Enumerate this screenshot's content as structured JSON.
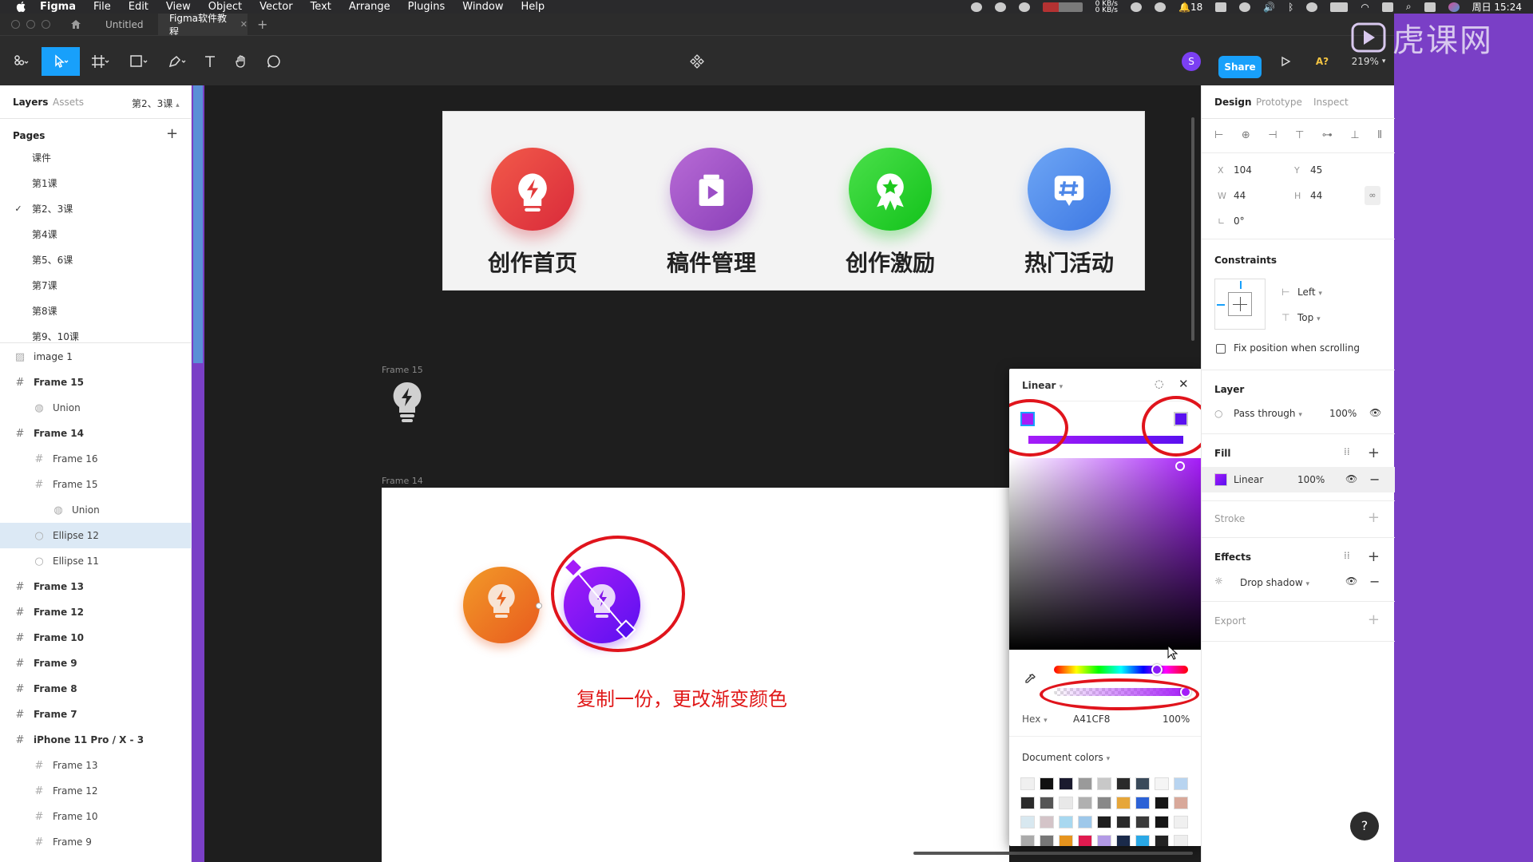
{
  "menubar": {
    "app": "Figma",
    "items": [
      "File",
      "Edit",
      "View",
      "Object",
      "Vector",
      "Text",
      "Arrange",
      "Plugins",
      "Window",
      "Help"
    ],
    "net_speed": "0 KB/s",
    "net_speed2": "0 KB/s",
    "notif_count": "18",
    "clock": "周日 15:24"
  },
  "tabs": {
    "home_icon": "home-icon",
    "tab1": "Untitled",
    "tab2": "Figma软件教程",
    "add": "+"
  },
  "toolbar": {
    "avatar_letter": "S",
    "share": "Share",
    "ai_label": "A?",
    "zoom": "219%"
  },
  "watermark": "虎课网",
  "left": {
    "tab_layers": "Layers",
    "tab_assets": "Assets",
    "page_selector": "第2、3课",
    "pages_title": "Pages",
    "pages": [
      "课件",
      "第1课",
      "第2、3课",
      "第4课",
      "第5、6课",
      "第7课",
      "第8课",
      "第9、10课"
    ],
    "current_page_index": 2,
    "layers": [
      {
        "name": "image 1",
        "type": "image",
        "indent": 0
      },
      {
        "name": "Frame 15",
        "type": "frame",
        "indent": 0,
        "bold": true
      },
      {
        "name": "Union",
        "type": "union",
        "indent": 1
      },
      {
        "name": "Frame 14",
        "type": "frame",
        "indent": 0,
        "bold": true
      },
      {
        "name": "Frame 16",
        "type": "frame",
        "indent": 1
      },
      {
        "name": "Frame 15",
        "type": "frame",
        "indent": 1
      },
      {
        "name": "Union",
        "type": "union",
        "indent": 2
      },
      {
        "name": "Ellipse 12",
        "type": "ellipse",
        "indent": 1,
        "selected": true
      },
      {
        "name": "Ellipse 11",
        "type": "ellipse",
        "indent": 1
      },
      {
        "name": "Frame 13",
        "type": "frame",
        "indent": 0,
        "bold": true
      },
      {
        "name": "Frame 12",
        "type": "frame",
        "indent": 0,
        "bold": true
      },
      {
        "name": "Frame 10",
        "type": "frame",
        "indent": 0,
        "bold": true
      },
      {
        "name": "Frame 9",
        "type": "frame",
        "indent": 0,
        "bold": true
      },
      {
        "name": "Frame 8",
        "type": "frame",
        "indent": 0,
        "bold": true
      },
      {
        "name": "Frame 7",
        "type": "frame",
        "indent": 0,
        "bold": true
      },
      {
        "name": "iPhone 11 Pro / X - 3",
        "type": "frame",
        "indent": 0,
        "bold": true
      },
      {
        "name": "Frame 13",
        "type": "frame",
        "indent": 1
      },
      {
        "name": "Frame 12",
        "type": "frame",
        "indent": 1
      },
      {
        "name": "Frame 10",
        "type": "frame",
        "indent": 1
      },
      {
        "name": "Frame 9",
        "type": "frame",
        "indent": 1
      }
    ]
  },
  "canvas": {
    "banner_items": [
      {
        "label": "创作首页",
        "color_a": "#f25a4a",
        "color_b": "#d92a3a",
        "icon": "bulb-bolt-icon"
      },
      {
        "label": "稿件管理",
        "color_a": "#b86bd6",
        "color_b": "#8a3fb8",
        "icon": "play-doc-icon"
      },
      {
        "label": "创作激励",
        "color_a": "#4be04b",
        "color_b": "#12c21a",
        "icon": "award-star-icon"
      },
      {
        "label": "热门活动",
        "color_a": "#6ea6f5",
        "color_b": "#3d78e3",
        "icon": "hashtag-icon"
      }
    ],
    "frame15_label": "Frame 15",
    "frame14_label": "Frame 14",
    "annotation": "复制一份，更改渐变颜色"
  },
  "picker": {
    "type": "Linear",
    "hex_label": "Hex",
    "hex_value": "A41CF8",
    "opacity": "100%",
    "doc_colors_title": "Document colors",
    "stop1_color": "#a41cf8",
    "stop2_color": "#5a10f0",
    "doc_colors": [
      "#f0f0f0",
      "#111111",
      "#1a1a2e",
      "#9a9a9a",
      "#c8c8c8",
      "#2a2a2a",
      "#3a4a5a",
      "#f5f5f5",
      "#b8d4f0",
      "#2a2a2a",
      "#555555",
      "#e8e8e8",
      "#b0b0b0",
      "#888888",
      "#e6a63a",
      "#2c62d6",
      "#151515",
      "#d8a89a",
      "#d8e8f0",
      "#d4c4c8",
      "#a8d8f0",
      "#9ec8ea",
      "#1e1e1e",
      "#2a2a2a",
      "#3a3a3a",
      "#151515",
      "#f0f0f0",
      "#aaaaaa",
      "#777777",
      "#e6941e",
      "#e01a4f",
      "#b39ae6",
      "#1a2a4a",
      "#2aa8e6",
      "#222222",
      "#eeeeee"
    ]
  },
  "right": {
    "tab_design": "Design",
    "tab_prototype": "Prototype",
    "tab_inspect": "Inspect",
    "x_label": "X",
    "x": "104",
    "y_label": "Y",
    "y": "45",
    "w_label": "W",
    "w": "44",
    "h_label": "H",
    "h": "44",
    "rotation": "0°",
    "constraints_title": "Constraints",
    "constraint_h": "Left",
    "constraint_v": "Top",
    "fix_position": "Fix position when scrolling",
    "layer_title": "Layer",
    "blend": "Pass through",
    "layer_opacity": "100%",
    "fill_title": "Fill",
    "fill_type": "Linear",
    "fill_opacity": "100%",
    "stroke_title": "Stroke",
    "effects_title": "Effects",
    "effect": "Drop shadow",
    "export_title": "Export",
    "help": "?"
  }
}
